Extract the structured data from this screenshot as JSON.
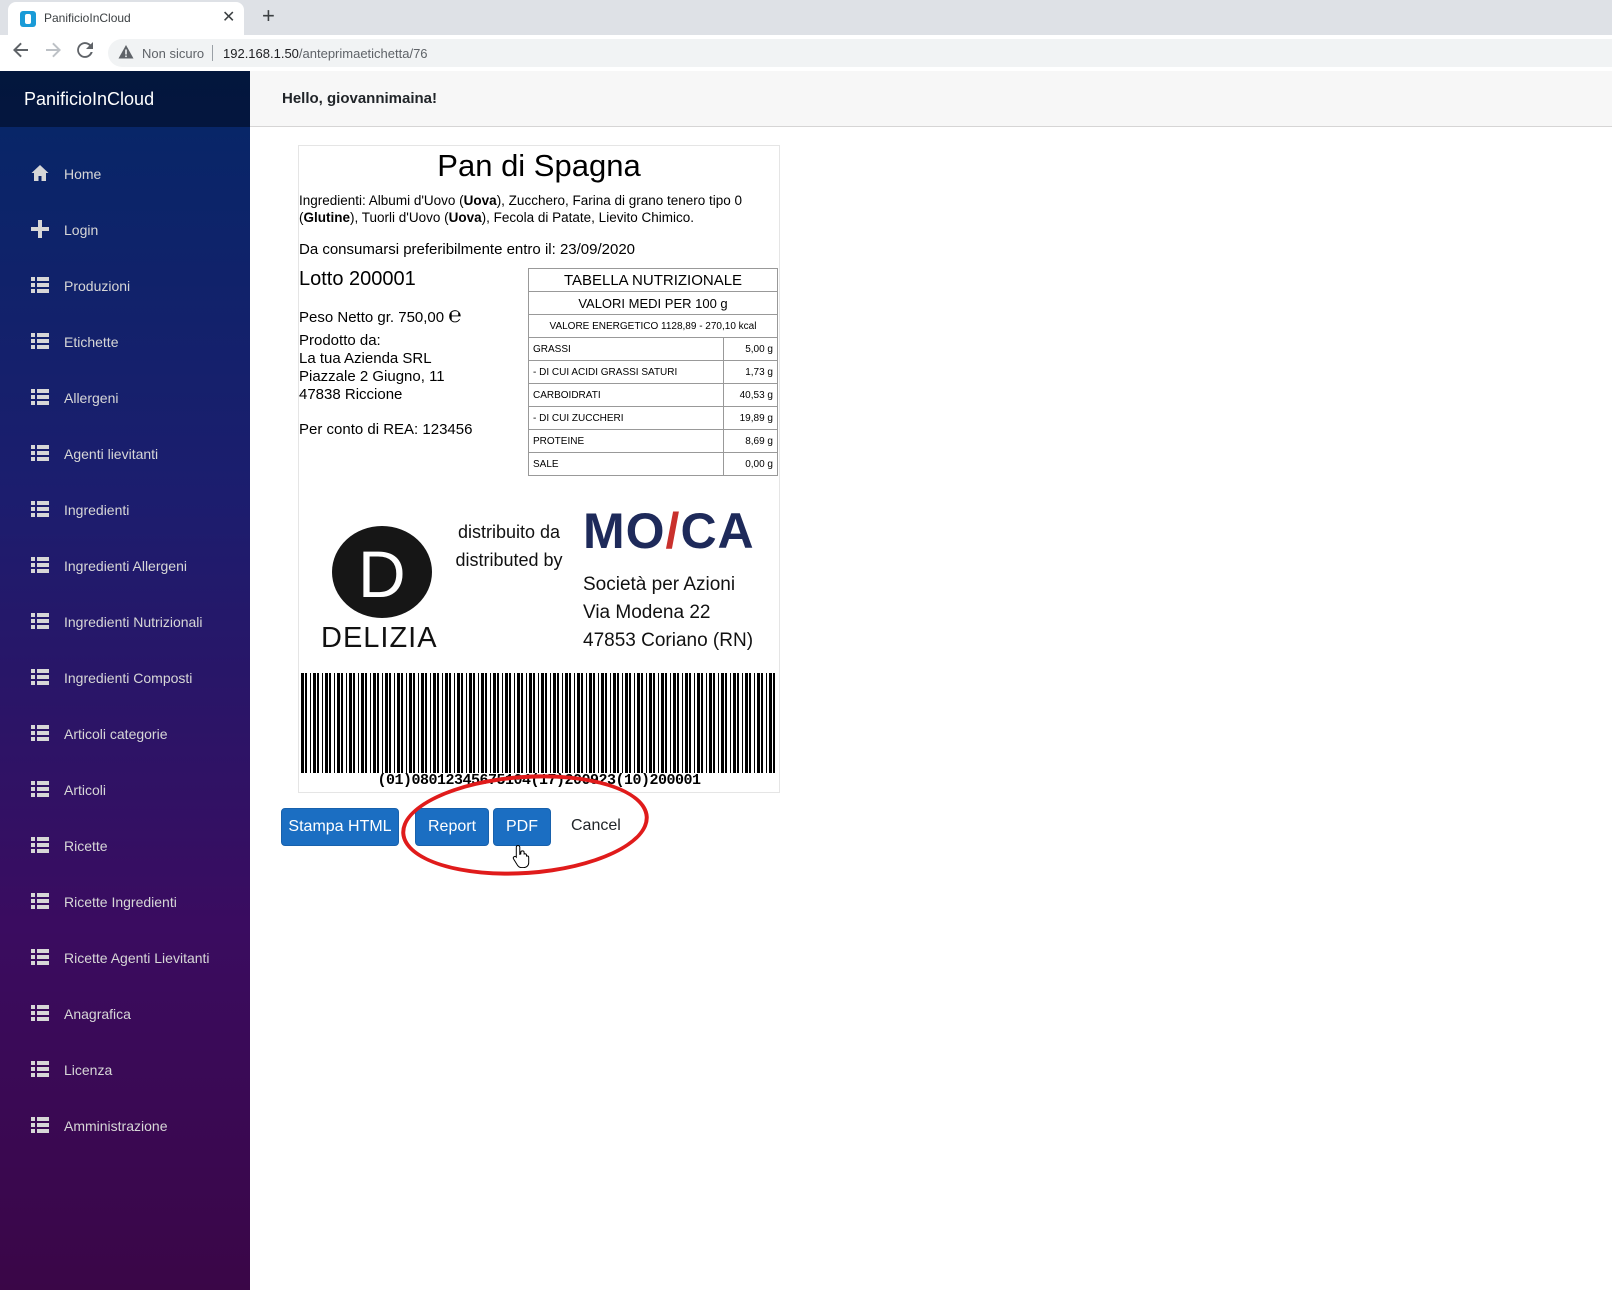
{
  "browser": {
    "tab_title": "PanificioInCloud",
    "tab_close": "✕",
    "new_tab": "+",
    "not_secure": "Non sicuro",
    "url_host": "192.168.1.50",
    "url_path": "/anteprimaetichetta/76"
  },
  "sidebar": {
    "brand": "PanificioInCloud",
    "items": [
      {
        "label": "Home",
        "icon": "home-icon"
      },
      {
        "label": "Login",
        "icon": "plus-icon"
      },
      {
        "label": "Produzioni",
        "icon": "list-icon"
      },
      {
        "label": "Etichette",
        "icon": "list-icon"
      },
      {
        "label": "Allergeni",
        "icon": "list-icon"
      },
      {
        "label": "Agenti lievitanti",
        "icon": "list-icon"
      },
      {
        "label": "Ingredienti",
        "icon": "list-icon"
      },
      {
        "label": "Ingredienti Allergeni",
        "icon": "list-icon"
      },
      {
        "label": "Ingredienti Nutrizionali",
        "icon": "list-icon"
      },
      {
        "label": "Ingredienti Composti",
        "icon": "list-icon"
      },
      {
        "label": "Articoli categorie",
        "icon": "list-icon"
      },
      {
        "label": "Articoli",
        "icon": "list-icon"
      },
      {
        "label": "Ricette",
        "icon": "list-icon"
      },
      {
        "label": "Ricette Ingredienti",
        "icon": "list-icon"
      },
      {
        "label": "Ricette Agenti Lievitanti",
        "icon": "list-icon"
      },
      {
        "label": "Anagrafica",
        "icon": "list-icon"
      },
      {
        "label": "Licenza",
        "icon": "list-icon"
      },
      {
        "label": "Amministrazione",
        "icon": "list-icon"
      }
    ]
  },
  "header": {
    "greeting": "Hello, giovannimaina!"
  },
  "label": {
    "product_name": "Pan di Spagna",
    "ingredients_prefix": "Ingredienti: Albumi d'Uovo (",
    "allergen_1": "Uova",
    "ingredients_mid1": "), Zucchero, Farina di grano tenero tipo 0 (",
    "allergen_2": "Glutine",
    "ingredients_mid2": "), Tuorli d'Uovo (",
    "allergen_3": "Uova",
    "ingredients_suffix": "), Fecola di Patate, Lievito Chimico.",
    "expiry": "Da consumarsi preferibilmente entro il: 23/09/2020",
    "lot": "Lotto 200001",
    "net_weight": "Peso Netto gr. 750,00",
    "estimated_mark": "℮",
    "producer_heading": "Prodotto da:",
    "producer_name": "La tua Azienda SRL",
    "producer_street": "Piazzale 2 Giugno, 11",
    "producer_city": "47838 Riccione",
    "on_behalf": "Per conto di REA: 123456",
    "distributed_it": "distribuito da",
    "distributed_en": "distributed by",
    "brand_left_letter": "D",
    "brand_left": "DELIZIA",
    "brand_right_a": "MO",
    "brand_right_b": "CA",
    "distributor_type": "Società per Azioni",
    "distributor_street": "Via Modena 22",
    "distributor_city": "47853 Coriano (RN)",
    "barcode_text": "(01)08012345675104(17)200923(10)200001"
  },
  "nutrition": {
    "title": "TABELLA NUTRIZIONALE",
    "subtitle": "VALORI MEDI PER 100 g",
    "energy": "VALORE ENERGETICO 1128,89 - 270,10 kcal",
    "rows": [
      {
        "name": "GRASSI",
        "value": "5,00 g"
      },
      {
        "name": "- DI CUI ACIDI GRASSI SATURI",
        "value": "1,73 g"
      },
      {
        "name": "CARBOIDRATI",
        "value": "40,53 g"
      },
      {
        "name": "- DI CUI ZUCCHERI",
        "value": "19,89 g"
      },
      {
        "name": "PROTEINE",
        "value": "8,69 g"
      },
      {
        "name": "SALE",
        "value": "0,00 g"
      }
    ]
  },
  "actions": {
    "print_html": "Stampa HTML",
    "report": "Report",
    "pdf": "PDF",
    "cancel": "Cancel"
  },
  "annotation_color": "#e01b1b",
  "sidebar_gradient": [
    "#052767",
    "#3a0647"
  ],
  "button_color": "#1b6ec2"
}
